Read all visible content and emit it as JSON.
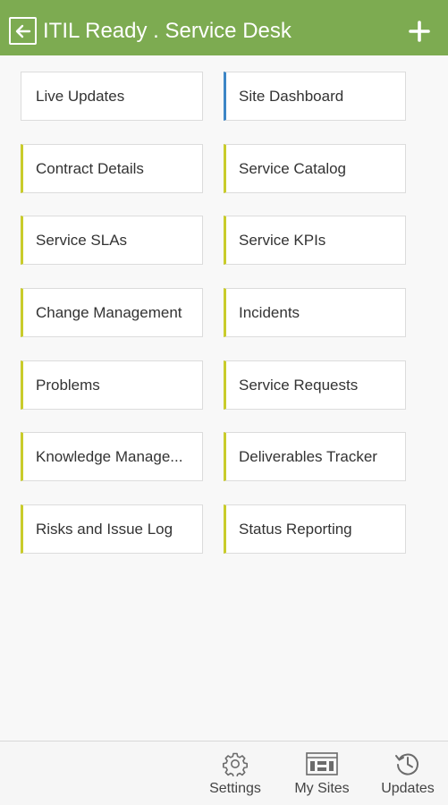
{
  "header": {
    "title": "ITIL Ready . Service Desk",
    "back_icon": "back-arrow-icon",
    "add_icon": "plus-icon"
  },
  "colors": {
    "header_bg": "#7dab51",
    "tile_accent_yellow": "#c9cc2b",
    "tile_accent_blue": "#3d86c6"
  },
  "tiles": [
    {
      "label": "Live Updates"
    },
    {
      "label": "Site Dashboard"
    },
    {
      "label": "Contract Details"
    },
    {
      "label": "Service Catalog"
    },
    {
      "label": "Service SLAs"
    },
    {
      "label": "Service KPIs"
    },
    {
      "label": "Change Management"
    },
    {
      "label": "Incidents"
    },
    {
      "label": "Problems"
    },
    {
      "label": "Service Requests"
    },
    {
      "label": "Knowledge Manage..."
    },
    {
      "label": "Deliverables Tracker"
    },
    {
      "label": "Risks and Issue Log"
    },
    {
      "label": "Status Reporting"
    }
  ],
  "bottom_nav": [
    {
      "label": "Settings",
      "icon": "gear-icon"
    },
    {
      "label": "My Sites",
      "icon": "sites-icon"
    },
    {
      "label": "Updates",
      "icon": "history-icon"
    }
  ]
}
